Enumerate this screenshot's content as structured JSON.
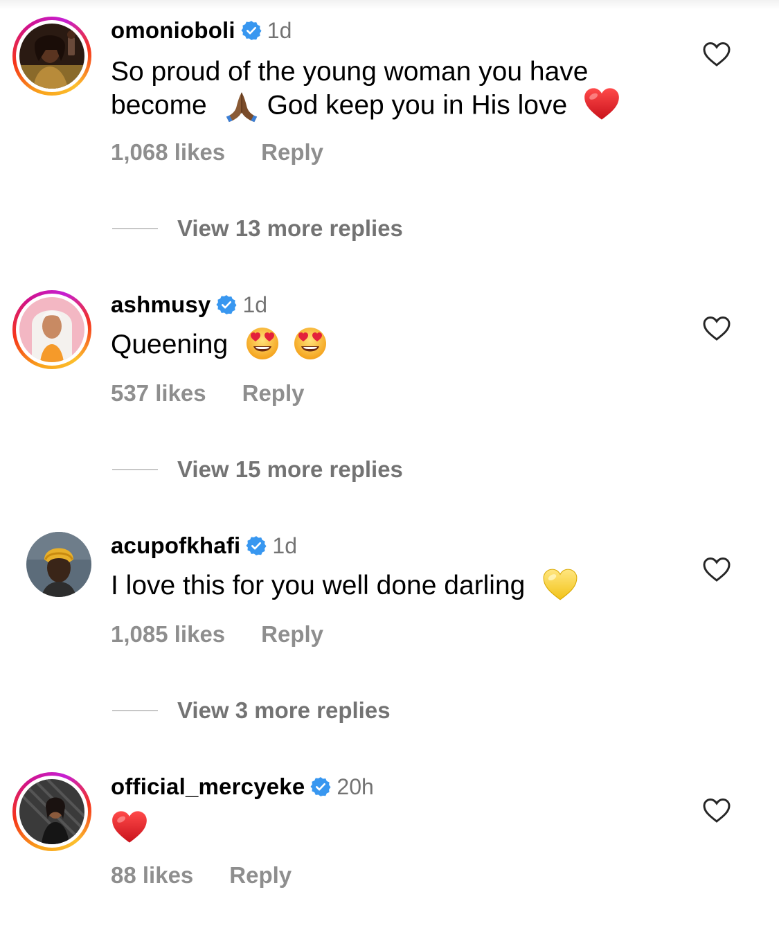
{
  "comments": [
    {
      "username": "omonioboli",
      "time": "1d",
      "text_line1": "So proud of the young woman you have",
      "text_line2_a": "become",
      "text_line2_b": "God keep you in His love",
      "likes": "1,068 likes",
      "reply_label": "Reply",
      "view_replies": "View 13 more replies",
      "emojis": [
        "folded-hands-emoji",
        "red-heart-emoji"
      ]
    },
    {
      "username": "ashmusy",
      "time": "1d",
      "text": "Queening",
      "likes": "537 likes",
      "reply_label": "Reply",
      "view_replies": "View 15 more replies",
      "emojis": [
        "heart-eyes-emoji",
        "heart-eyes-emoji"
      ]
    },
    {
      "username": "acupofkhafi",
      "time": "1d",
      "text": "I love this for you well done darling",
      "likes": "1,085 likes",
      "reply_label": "Reply",
      "view_replies": "View 3 more replies",
      "emojis": [
        "yellow-heart-emoji"
      ]
    },
    {
      "username": "official_mercyeke",
      "time": "20h",
      "text": "",
      "likes": "88 likes",
      "reply_label": "Reply",
      "emojis": [
        "red-heart-emoji"
      ]
    }
  ],
  "colors": {
    "verified_blue": "#3897f0",
    "meta_gray": "#8e8e8e",
    "view_gray": "#737373"
  },
  "icons": [
    "verified-badge-icon",
    "heart-outline-icon"
  ]
}
